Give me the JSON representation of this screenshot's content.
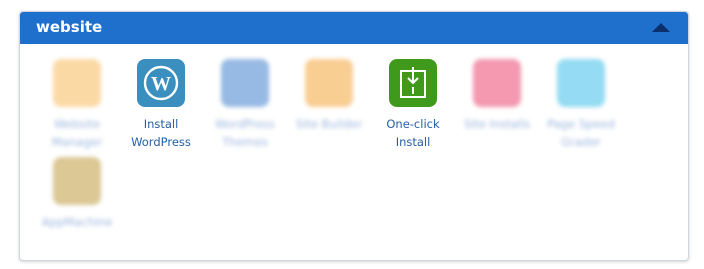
{
  "panel": {
    "title": "website"
  },
  "apps": [
    {
      "label": "Website Manager",
      "color": "#f7b24a",
      "icon": "website-manager-icon",
      "blurred": true
    },
    {
      "label": "Install WordPress",
      "color": "#3a8fbf",
      "icon": "wordpress-icon",
      "blurred": false
    },
    {
      "label": "WordPress Themes",
      "color": "#2d73c9",
      "icon": "wordpress-themes-icon",
      "blurred": true
    },
    {
      "label": "Site Builder",
      "color": "#f39b26",
      "icon": "site-builder-icon",
      "blurred": true
    },
    {
      "label": "One-click Install",
      "color": "#3f9a1b",
      "icon": "one-click-install-icon",
      "blurred": false
    },
    {
      "label": "Site Installs",
      "color": "#e8315e",
      "icon": "site-installs-icon",
      "blurred": true
    },
    {
      "label": "Page Speed Grader",
      "color": "#27b6e6",
      "icon": "page-speed-icon",
      "blurred": true
    },
    {
      "label": "AppMachine",
      "color": "#b8902a",
      "icon": "appmachine-icon",
      "blurred": true
    }
  ]
}
